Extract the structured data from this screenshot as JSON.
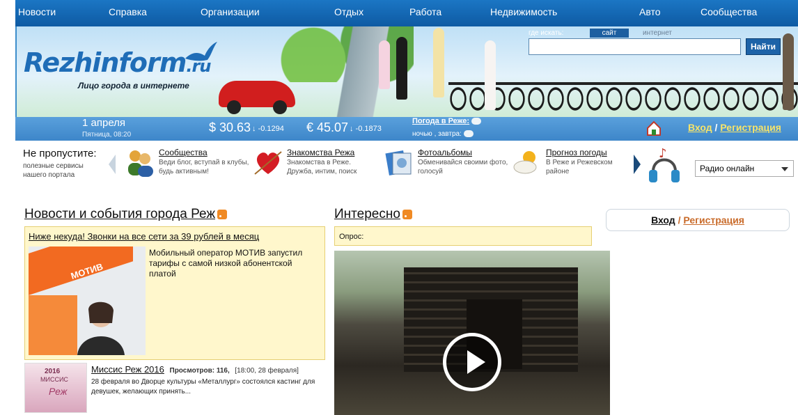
{
  "topnav": {
    "items": [
      "Новости",
      "Справка",
      "Организации",
      "Отдых",
      "Работа",
      "Недвижимость",
      "Авто",
      "Сообщества"
    ]
  },
  "header": {
    "logo_main": "Rezhinform",
    "logo_tld": ".ru",
    "slogan": "Лицо города в интернете",
    "search": {
      "where_label": "где искать:",
      "scope_site": "сайт",
      "scope_internet": "интернет",
      "value": "",
      "button_label": "Найти"
    }
  },
  "infobar": {
    "date": "1 апреля",
    "day_time": "Пятница, 08:20",
    "usd_rate": "$ 30.63",
    "usd_delta": "↓ -0.1294",
    "eur_rate": "€ 45.07",
    "eur_delta": "↓ -0.1873",
    "weather_label": "Погода в Реже:",
    "weather_sub": "ночью , завтра:",
    "login": "Вход",
    "separator": "/",
    "register": "Регистрация"
  },
  "services": {
    "title": "Не пропустите:",
    "subtitle": "полезные сервисы нашего портала",
    "items": [
      {
        "title": "Сообщества",
        "desc": "Веди блог, вступай в клубы, будь активным!",
        "icon": "people-icon"
      },
      {
        "title": "Знакомства Режа",
        "desc": "Знакомства в Реже. Дружба, интим, поиск",
        "icon": "heart-icon"
      },
      {
        "title": "Фотоальбомы",
        "desc": "Обменивайся своими фото, голосуй",
        "icon": "photo-album-icon"
      },
      {
        "title": "Прогноз погоды",
        "desc": "В Реже и Режевском районе",
        "icon": "weather-icon"
      }
    ],
    "radio_select": "Радио онлайн"
  },
  "news": {
    "heading": "Новости и события города Реж",
    "featured": {
      "title": "Ниже некуда! Звонки на все сети за 39 рублей в месяц",
      "text": "Мобильный оператор МОТИВ запустил тарифы с самой низкой абонентской платой",
      "image_caption": "МОТИВ"
    },
    "item2": {
      "title": "Миссис Реж 2016",
      "views_label": "Просмотров: 116,",
      "date": "[18:00, 28 февраля]",
      "text": "28 февраля во Дворце культуры «Металлург» состоялся кастинг для девушек, желающих принять...",
      "badge_year": "2016",
      "badge_title": "МИССИС",
      "badge_name": "Реж"
    }
  },
  "interesting": {
    "heading": "Интересно",
    "poll_label": "Опрос:"
  },
  "login_box": {
    "login": "Вход",
    "separator": "/",
    "register": "Регистрация"
  },
  "colors": {
    "nav_blue": "#1b76c4",
    "info_blue": "#3d86c9",
    "highlight_yellow": "#fff7cc",
    "accent_orange": "#c96b2a"
  }
}
